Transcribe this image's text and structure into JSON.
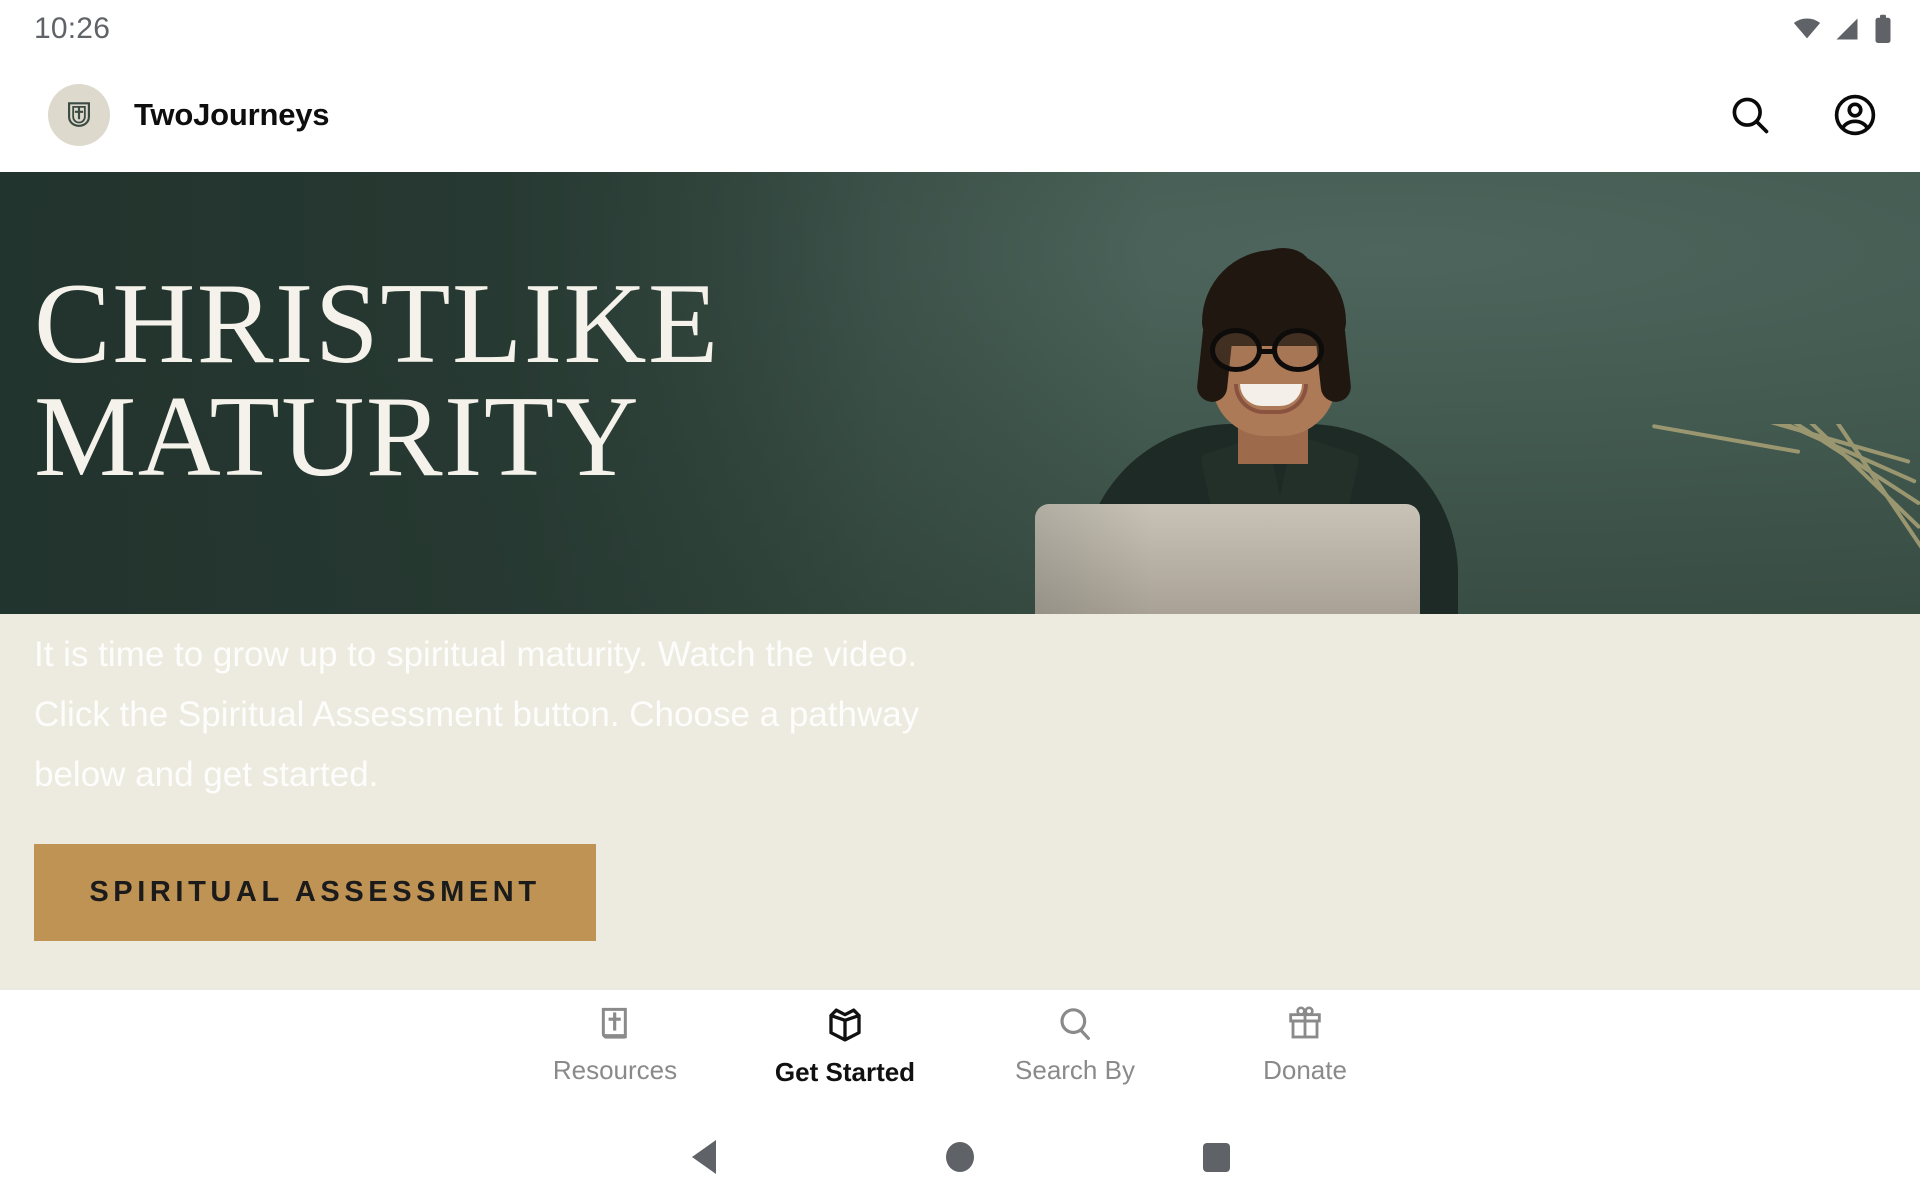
{
  "status_bar": {
    "time": "10:26",
    "icons": [
      "wifi-icon",
      "cellular-signal-icon",
      "battery-icon"
    ]
  },
  "app_bar": {
    "logo_icon": "twojourneys-shield-cross-logo",
    "brand_name": "TwoJourneys",
    "actions": [
      {
        "icon": "search-icon",
        "label": "Search"
      },
      {
        "icon": "account-circle-icon",
        "label": "Account"
      }
    ]
  },
  "hero": {
    "title_line1": "CHRISTLIKE",
    "title_line2": "MATURITY",
    "image_alt": "Smiling woman with glasses working on a laptop against a dark green wall with a plant",
    "background_color": "#3b564e",
    "title_color": "#f4f2ea"
  },
  "content": {
    "lead_paragraph": "It is time to grow up to spiritual maturity. Watch the video. Click the Spiritual Assessment button. Choose a pathway below and get started.",
    "cta_label": "SPIRITUAL ASSESSMENT",
    "cta_color": "#bf9353",
    "section_background": "#edeae0"
  },
  "bottom_nav": {
    "items": [
      {
        "label": "Resources",
        "icon": "bible-book-cross-icon",
        "active": false
      },
      {
        "label": "Get Started",
        "icon": "open-box-package-icon",
        "active": true
      },
      {
        "label": "Search By",
        "icon": "search-icon",
        "active": false
      },
      {
        "label": "Donate",
        "icon": "gift-box-icon",
        "active": false
      }
    ]
  },
  "android_nav": {
    "back": "back-triangle-icon",
    "home": "home-circle-icon",
    "recents": "recents-square-icon"
  }
}
